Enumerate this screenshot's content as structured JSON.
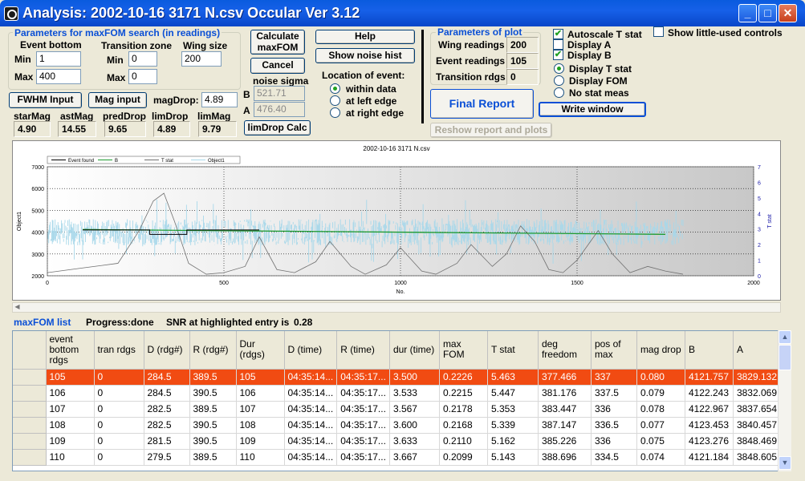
{
  "window": {
    "title": "Analysis: 2002-10-16 3171 N.csv  Occular Ver 3.12",
    "minimize": "_",
    "maximize": "□",
    "close": "✕"
  },
  "search": {
    "group_title": "Parameters for maxFOM search (in readings)",
    "event_bottom_label": "Event bottom",
    "min_label": "Min",
    "max_label": "Max",
    "eb_min": "1",
    "eb_max": "400",
    "trans_label": "Transition zone",
    "tz_min": "0",
    "tz_max": "0",
    "wing_label": "Wing size",
    "wing": "200"
  },
  "buttons": {
    "calc": "Calculate maxFOM",
    "cancel": "Cancel",
    "help": "Help",
    "noise_hist": "Show noise hist",
    "fwhm": "FWHM Input",
    "mag": "Mag input",
    "limdrop": "limDrop Calc",
    "final_report": "Final Report",
    "write_window": "Write window",
    "reshow": "Reshow report and plots"
  },
  "noise": {
    "label": "noise sigma",
    "b_label": "B",
    "b": "521.71",
    "a_label": "A",
    "a": "476.40"
  },
  "location": {
    "title": "Location of event:",
    "options": [
      "within data",
      "at left edge",
      "at right edge"
    ],
    "selected": 0
  },
  "mag": {
    "magdrop_label": "magDrop:",
    "magdrop": "4.89",
    "labels": [
      "starMag",
      "astMag",
      "predDrop",
      "limDrop",
      "limMag"
    ],
    "values": [
      "4.90",
      "14.55",
      "9.65",
      "4.89",
      "9.79"
    ]
  },
  "plotparams": {
    "title": "Parameters of plot",
    "wing_label": "Wing readings",
    "wing": "200",
    "event_label": "Event readings",
    "event": "105",
    "trans_label": "Transition rdgs",
    "trans": "0"
  },
  "checks": {
    "autoscale": "Autoscale T stat",
    "display_a": "Display A",
    "display_b": "Display B",
    "little_used": "Show little-used controls",
    "autoscale_on": true,
    "a_on": false,
    "b_on": true,
    "little_on": false
  },
  "stat_radios": {
    "options": [
      "Display T stat",
      "Display FOM",
      "No stat meas"
    ],
    "selected": 0
  },
  "chart_data": {
    "type": "line",
    "title": "2002-10-16 3171 N.csv",
    "xlabel": "No.",
    "ylabel": "Object1",
    "y2label": "T stat",
    "xlim": [
      0,
      2000
    ],
    "ylim": [
      2000,
      7000
    ],
    "y2lim": [
      0,
      7
    ],
    "x_ticks": [
      0,
      500,
      1000,
      1500,
      2000
    ],
    "y_ticks": [
      2000,
      3000,
      4000,
      5000,
      6000,
      7000
    ],
    "y2_ticks": [
      0,
      1,
      2,
      3,
      4,
      5,
      6,
      7
    ],
    "legend": [
      "Event found",
      "B",
      "T stat",
      "Object1"
    ],
    "legend_position": "top-left",
    "grid": true,
    "event_found": {
      "x": [
        100,
        290,
        290,
        395,
        395,
        600
      ],
      "y": [
        4100,
        4100,
        3900,
        3900,
        4100,
        4100
      ]
    },
    "b_line": {
      "x": [
        100,
        1750
      ],
      "y": [
        4120,
        3900
      ]
    },
    "tstat_peaks": {
      "x": [
        0,
        100,
        200,
        260,
        300,
        330,
        360,
        400,
        450,
        500,
        560,
        600,
        650,
        700,
        760,
        800,
        860,
        900,
        960,
        1000,
        1060,
        1100,
        1160,
        1200,
        1260,
        1300,
        1340,
        1380,
        1420,
        1460,
        1500,
        1560,
        1600,
        1650,
        1700,
        1750,
        1800
      ],
      "y": [
        0.2,
        0.5,
        0.8,
        2.9,
        4.8,
        5.3,
        3.5,
        0.8,
        0.1,
        0.2,
        0.6,
        2.5,
        0.4,
        0.2,
        0.9,
        2.2,
        0.6,
        0.1,
        0.7,
        1.8,
        0.3,
        0.1,
        0.8,
        2.0,
        0.6,
        1.4,
        3.2,
        2.2,
        0.4,
        0.2,
        1.0,
        2.9,
        1.4,
        0.2,
        0.6,
        0.3,
        0.1
      ]
    },
    "noise_band": {
      "x_range": [
        0,
        1800
      ],
      "center": 4000,
      "spread": 600
    }
  },
  "status": {
    "list_title": "maxFOM list",
    "progress_label": "Progress:",
    "progress": "done",
    "snr_label": "SNR at highlighted entry is",
    "snr": "0.28"
  },
  "table": {
    "columns": [
      "event bottom rdgs",
      "tran rdgs",
      "D (rdg#)",
      "R (rdg#)",
      "Dur (rdgs)",
      "D (time)",
      "R (time)",
      "dur (time)",
      "max FOM",
      "T stat",
      "deg freedom",
      "pos of max",
      "mag drop",
      "B",
      "A"
    ],
    "rows": [
      [
        "105",
        "0",
        "284.5",
        "389.5",
        "105",
        "04:35:14...",
        "04:35:17...",
        "3.500",
        "0.2226",
        "5.463",
        "377.466",
        "337",
        "0.080",
        "4121.757",
        "3829.132"
      ],
      [
        "106",
        "0",
        "284.5",
        "390.5",
        "106",
        "04:35:14...",
        "04:35:17...",
        "3.533",
        "0.2215",
        "5.447",
        "381.176",
        "337.5",
        "0.079",
        "4122.243",
        "3832.069"
      ],
      [
        "107",
        "0",
        "282.5",
        "389.5",
        "107",
        "04:35:14...",
        "04:35:17...",
        "3.567",
        "0.2178",
        "5.353",
        "383.447",
        "336",
        "0.078",
        "4122.967",
        "3837.654"
      ],
      [
        "108",
        "0",
        "282.5",
        "390.5",
        "108",
        "04:35:14...",
        "04:35:17...",
        "3.600",
        "0.2168",
        "5.339",
        "387.147",
        "336.5",
        "0.077",
        "4123.453",
        "3840.457"
      ],
      [
        "109",
        "0",
        "281.5",
        "390.5",
        "109",
        "04:35:14...",
        "04:35:17...",
        "3.633",
        "0.2110",
        "5.162",
        "385.226",
        "336",
        "0.075",
        "4123.276",
        "3848.469"
      ],
      [
        "110",
        "0",
        "279.5",
        "389.5",
        "110",
        "04:35:14...",
        "04:35:17...",
        "3.667",
        "0.2099",
        "5.143",
        "388.696",
        "334.5",
        "0.074",
        "4121.184",
        "3848.605"
      ]
    ],
    "highlighted": 0
  }
}
